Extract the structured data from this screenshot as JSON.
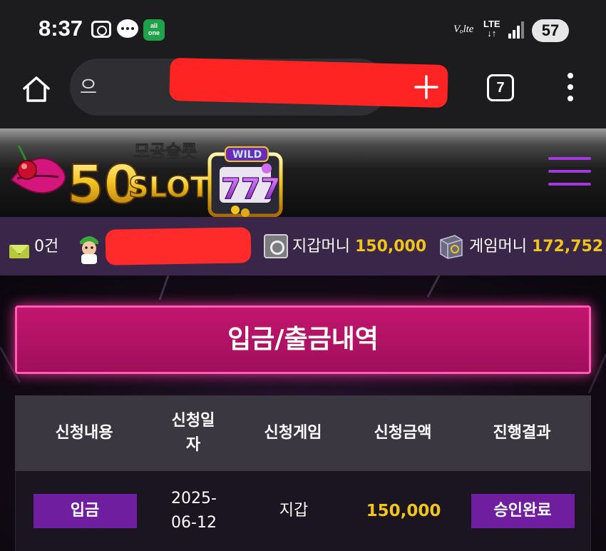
{
  "status_bar": {
    "time": "8:37",
    "allone_label_top": "all",
    "allone_label_bottom": "one",
    "volte": "Vₒlte",
    "lte_top": "LTE",
    "lte_bottom": "↓↑",
    "battery": "57",
    "icons": [
      "screenshot-icon",
      "chat-icon",
      "allone-app-icon",
      "signal-icon",
      "battery-icon"
    ]
  },
  "browser": {
    "url_visible": "으",
    "tab_count": "7",
    "icons": [
      "home-icon",
      "new-tab-plus-icon",
      "tabs-icon",
      "more-icon"
    ]
  },
  "header": {
    "logo_korean": "모공슬롯",
    "logo_number": "50",
    "logo_word": "SLOT",
    "logo_wild": "WILD",
    "logo_reels": "777",
    "menu_icon": "hamburger-icon",
    "accent": "#a338e0"
  },
  "user_bar": {
    "messages": "0건",
    "wallet_label": "지갑머니",
    "wallet_amount": "150,000",
    "game_label": "게임머니",
    "game_amount": "172,752"
  },
  "main": {
    "title": "입금/출금내역",
    "table": {
      "headers": [
        "신청내용",
        "신청일\n자",
        "신청게임",
        "신청금액",
        "진행결과"
      ],
      "rows": [
        {
          "type": "입금",
          "date": "2025-\n06-12",
          "game": "지갑",
          "amount": "150,000",
          "status": "승인완료"
        }
      ]
    }
  },
  "colors": {
    "title_bg": "#c2166e",
    "title_glow": "#ff5ab4",
    "gold": "#f0c419",
    "pill": "#6e1e9e",
    "user_bar_bg": "#3a2648"
  }
}
